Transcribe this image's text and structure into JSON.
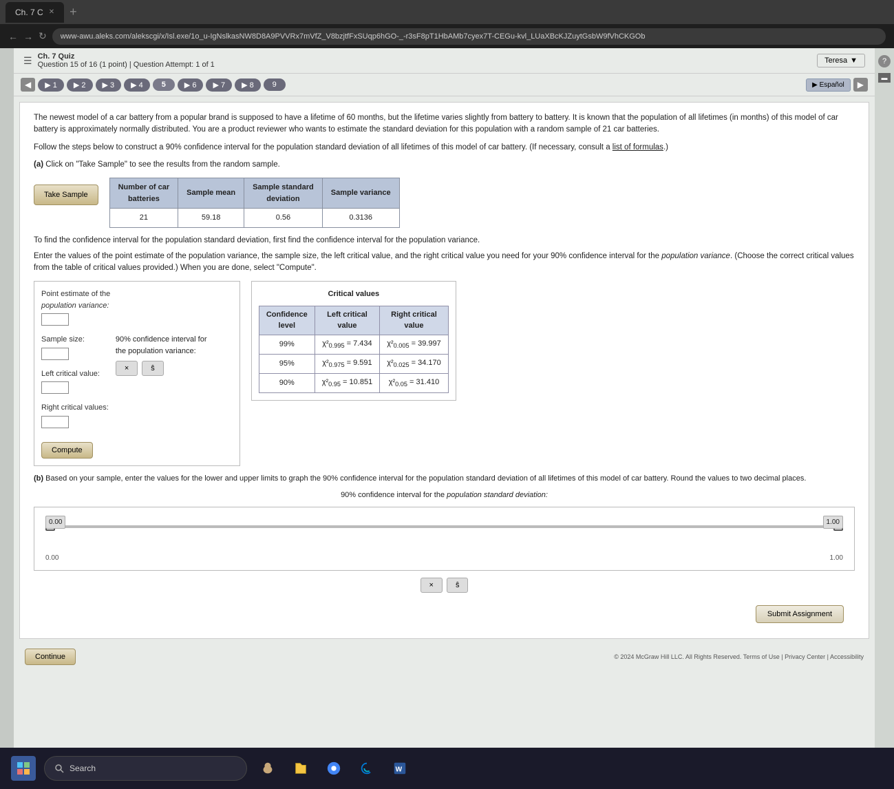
{
  "browser": {
    "tab_title": "Ch. 7 C",
    "url": "www-awu.aleks.com/alekscgi/x/Isl.exe/1o_u-IgNslkasNW8D8A9PVVRx7mVfZ_V8bzjtfFxSUqp6hGO-_-r3sF8pT1HbAMb7cyex7T-CEGu-kvl_LUaXBcKJZuytGsbW9fVhCKGOb"
  },
  "quiz": {
    "title": "Ch. 7 Quiz",
    "question_info": "Question 15 of 16 (1 point) | Question Attempt: 1 of 1",
    "teresa_label": "Teresa",
    "nav_buttons": [
      "1",
      "2",
      "3",
      "4",
      "5",
      "6",
      "7",
      "8",
      "9"
    ],
    "espanol_label": "Español"
  },
  "question": {
    "text": "The newest model of a car battery from a popular brand is supposed to have a lifetime of 60 months, but the lifetime varies slightly from battery to battery. It is known that the population of all lifetimes (in months) of this model of car battery is approximately normally distributed. You are a product reviewer who wants to estimate the standard deviation for this population with a random sample of 21 car batteries.",
    "instruction": "Follow the steps below to construct a 90% confidence interval for the population standard deviation of all lifetimes of this model of car battery. (If necessary, consult a list of formulas.)",
    "part_a_label": "(a)",
    "part_a_text": "Click on \"Take Sample\" to see the results from the random sample.",
    "take_sample_btn": "Take Sample",
    "table_headers": [
      "Number of car batteries",
      "Sample mean",
      "Sample standard deviation",
      "Sample variance"
    ],
    "table_row": [
      "21",
      "59.18",
      "0.56",
      "0.3136"
    ],
    "confidence_text": "To find the confidence interval for the population standard deviation, first find the confidence interval for the population variance.",
    "enter_values_text": "Enter the values of the point estimate of the population variance, the sample size, the left critical value, and the right critical value you need for your 90% confidence interval for the population variance. (Choose the correct critical values from the table of critical values provided.) When you are done, select \"Compute\".",
    "point_estimate_label": "Point estimate of the population variance:",
    "sample_size_label": "Sample size:",
    "left_critical_label": "Left critical value:",
    "right_critical_label": "Right critical value:",
    "confidence_interval_label": "90% confidence interval for the population variance:",
    "confidence_std_label": "90% confidence interval for the population standard deviation:",
    "x_btn": "×",
    "s_btn": "ŝ",
    "compute_btn": "Compute",
    "critical_values_title": "Critical values",
    "crit_table_headers": [
      "Confidence level",
      "Left critical value",
      "Right critical value"
    ],
    "crit_rows": [
      {
        "level": "99%",
        "left": "χ²₀.₉₉₅ = 7.434",
        "right": "χ²₀.₀₀₅ = 39.997"
      },
      {
        "level": "95%",
        "left": "χ²₀.₉₇₅ = 9.591",
        "right": "χ²₀.₀₂₅ = 34.170"
      },
      {
        "level": "90%",
        "left": "χ²₀.₉₅ = 10.851",
        "right": "χ²₀.₀₅ = 31.410"
      }
    ],
    "part_b_label": "(b)",
    "part_b_text": "Based on your sample, enter the values for the lower and upper limits to graph the 90% confidence interval for the population standard deviation of all lifetimes of this model of car battery. Round the values to two decimal places.",
    "interval_title": "90% confidence interval for the population standard deviation:",
    "slider_left_value": "0.00",
    "slider_right_value": "1.00",
    "slider_left_label": "0.00",
    "slider_right_label": "1.00",
    "submit_btn": "Submit Assignment",
    "continue_btn": "Continue",
    "footer_text": "© 2024 McGraw Hill LLC. All Rights Reserved. Terms of Use | Privacy Center | Accessibility"
  },
  "taskbar": {
    "search_placeholder": "Search"
  }
}
